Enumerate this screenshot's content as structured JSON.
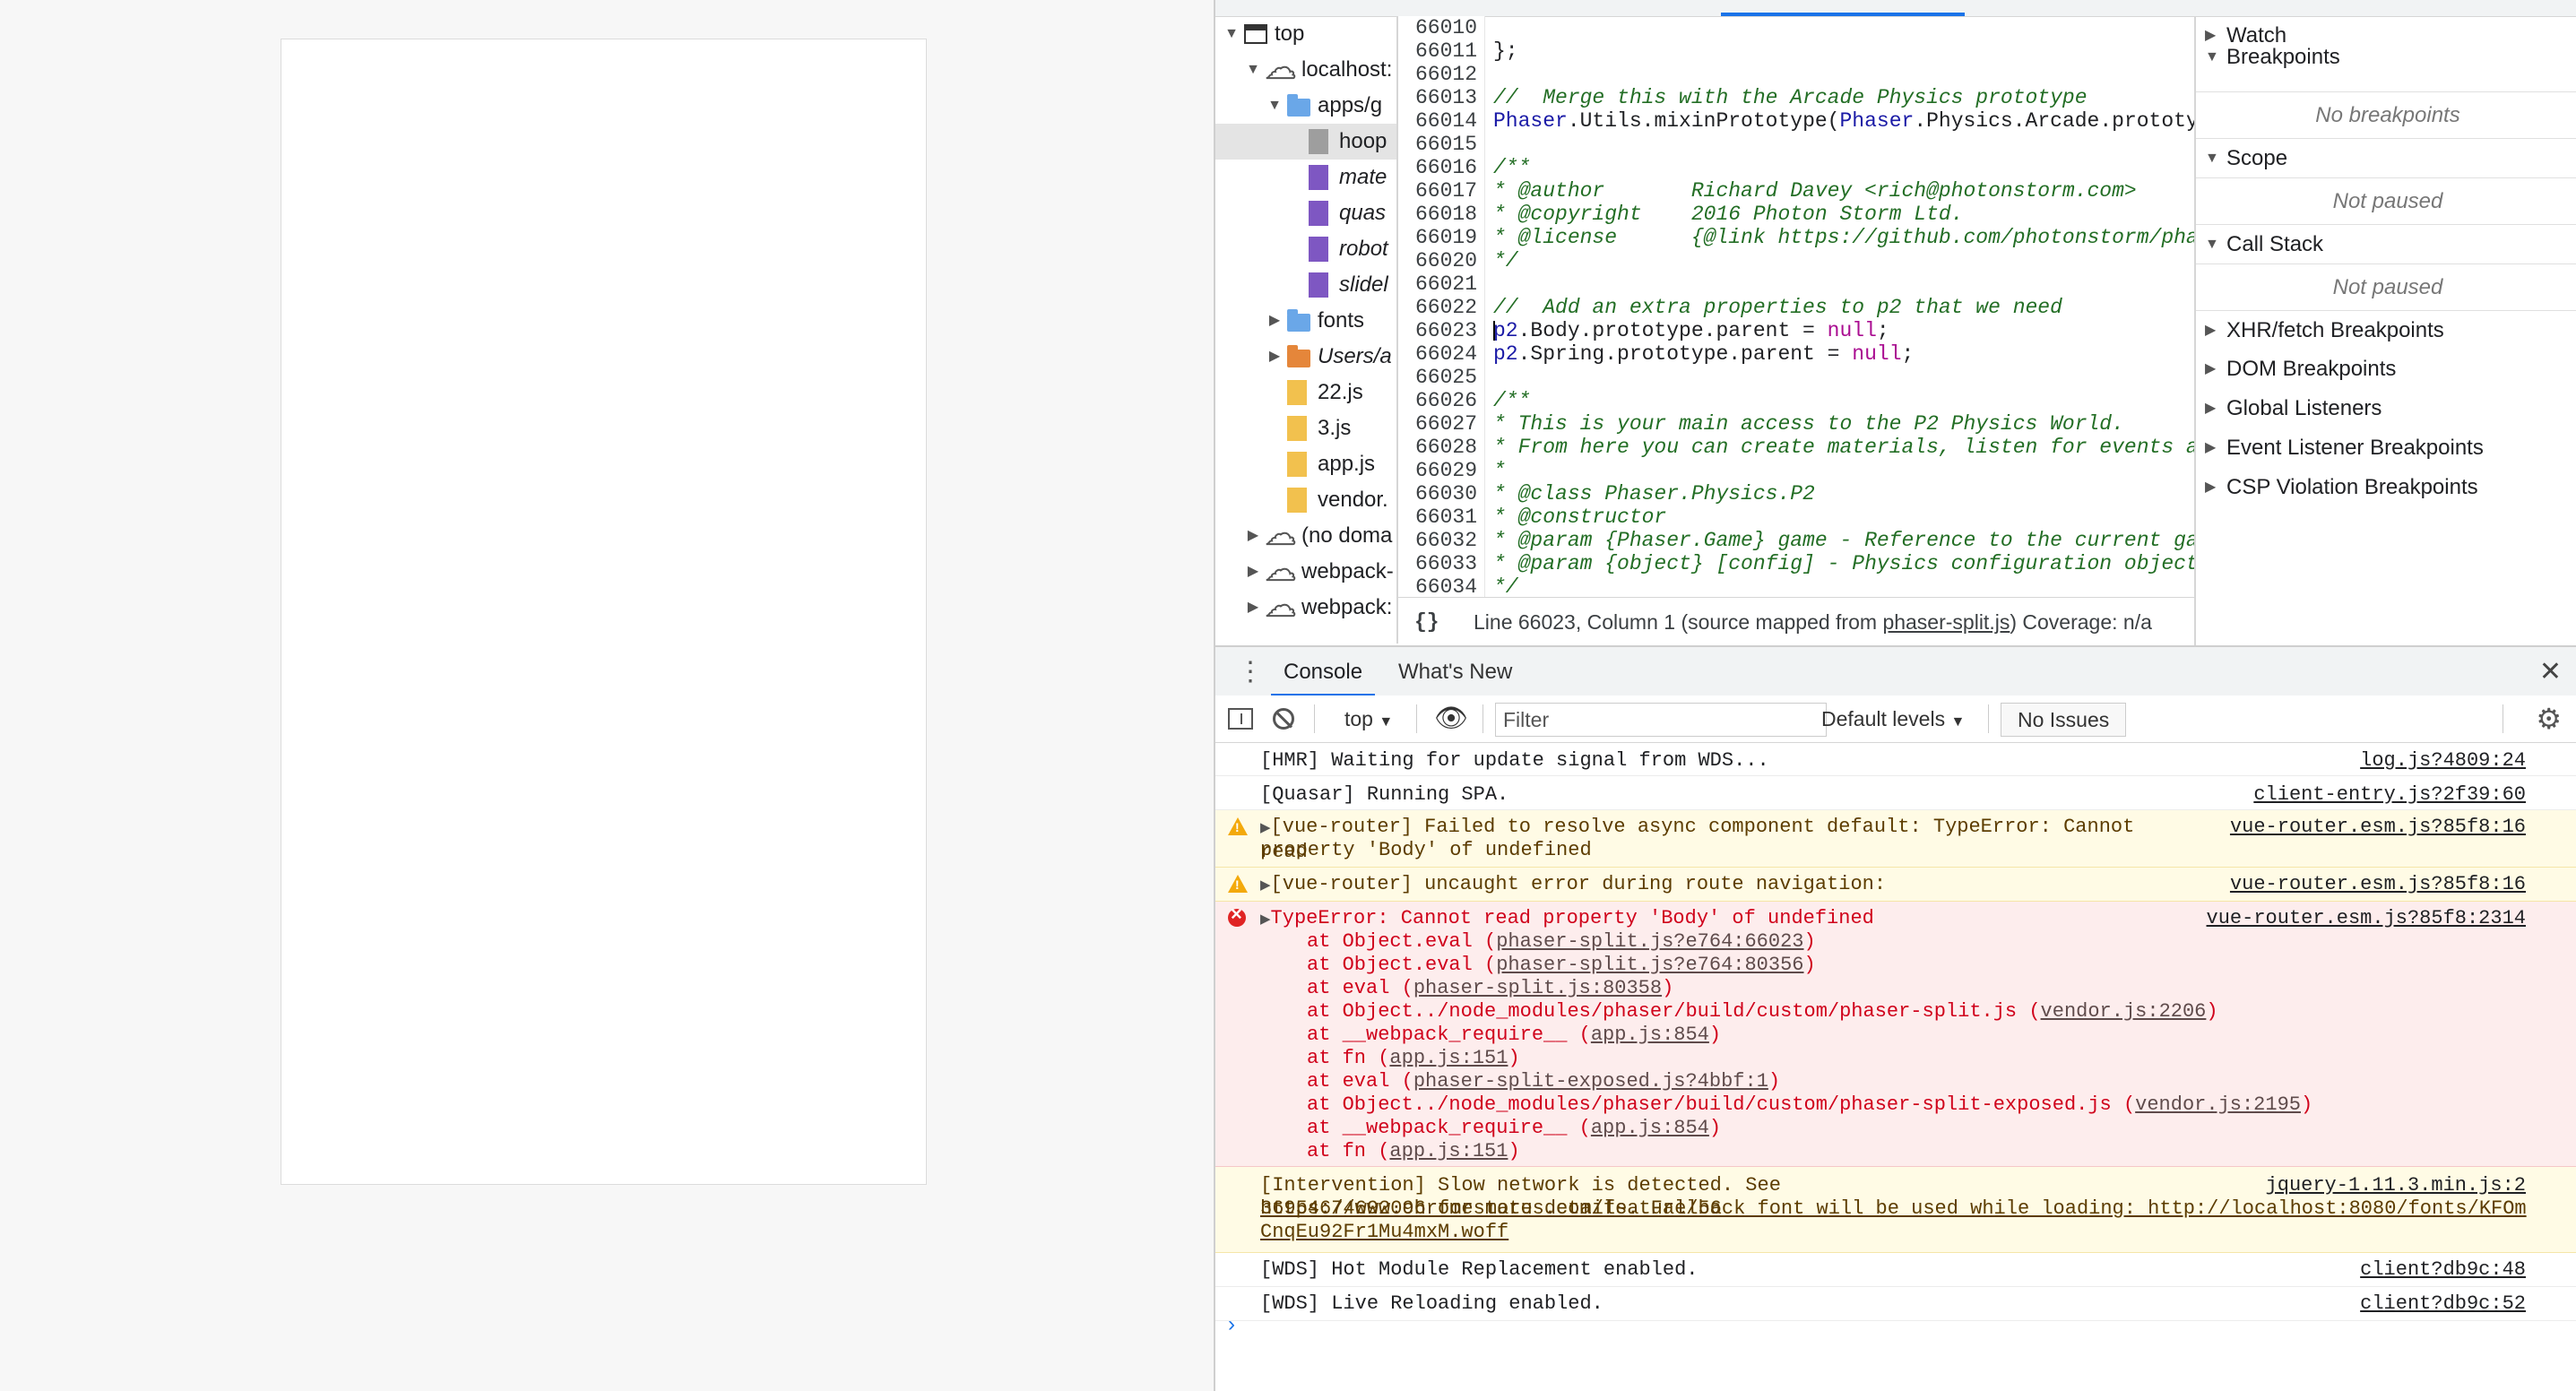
{
  "navigator": {
    "items": [
      {
        "label": "top",
        "type": "frame",
        "arrow": "▼"
      },
      {
        "label": "localhost:",
        "type": "cloud",
        "arrow": "▼"
      },
      {
        "label": "apps/g",
        "type": "folder",
        "arrow": "▼"
      },
      {
        "label": "hoop",
        "type": "file-gray",
        "arrow": ""
      },
      {
        "label": "mate",
        "type": "file-purple",
        "arrow": "",
        "italic": true
      },
      {
        "label": "quas",
        "type": "file-purple",
        "arrow": "",
        "italic": true
      },
      {
        "label": "robot",
        "type": "file-purple",
        "arrow": "",
        "italic": true
      },
      {
        "label": "slidel",
        "type": "file-purple",
        "arrow": "",
        "italic": true
      },
      {
        "label": "fonts",
        "type": "folder",
        "arrow": "▶"
      },
      {
        "label": "Users/a",
        "type": "folder-orange",
        "arrow": "▶",
        "italic": true
      },
      {
        "label": "22.js",
        "type": "file-yellow",
        "arrow": ""
      },
      {
        "label": "3.js",
        "type": "file-yellow",
        "arrow": ""
      },
      {
        "label": "app.js",
        "type": "file-yellow",
        "arrow": ""
      },
      {
        "label": "vendor.",
        "type": "file-yellow",
        "arrow": ""
      },
      {
        "label": "(no doma",
        "type": "cloud",
        "arrow": "▶"
      },
      {
        "label": "webpack-",
        "type": "cloud",
        "arrow": "▶"
      },
      {
        "label": "webpack:",
        "type": "cloud",
        "arrow": "▶"
      }
    ]
  },
  "editor": {
    "lines": [
      {
        "n": "66010",
        "text": ""
      },
      {
        "n": "66011",
        "text": "};"
      },
      {
        "n": "66012",
        "text": ""
      },
      {
        "n": "66013",
        "text": "//  Merge this with the Arcade Physics prototype",
        "kind": "comment"
      },
      {
        "n": "66014",
        "text": "Phaser.Utils.mixinPrototype(Phaser.Physics.Arcade.prototype",
        "kind": "ident"
      },
      {
        "n": "66015",
        "text": ""
      },
      {
        "n": "66016",
        "text": "/**",
        "kind": "comment"
      },
      {
        "n": "66017",
        "text": "* @author       Richard Davey <rich@photonstorm.com>",
        "kind": "comment"
      },
      {
        "n": "66018",
        "text": "* @copyright    2016 Photon Storm Ltd.",
        "kind": "comment"
      },
      {
        "n": "66019",
        "text": "* @license      {@link https://github.com/photonstorm/phase",
        "kind": "comment"
      },
      {
        "n": "66020",
        "text": "*/",
        "kind": "comment"
      },
      {
        "n": "66021",
        "text": ""
      },
      {
        "n": "66022",
        "text": "//  Add an extra properties to p2 that we need",
        "kind": "comment"
      },
      {
        "n": "66023",
        "text": "p2.Body.prototype.parent = null;",
        "kind": "ident",
        "cursor": true
      },
      {
        "n": "66024",
        "text": "p2.Spring.prototype.parent = null;",
        "kind": "ident"
      },
      {
        "n": "66025",
        "text": ""
      },
      {
        "n": "66026",
        "text": "/**",
        "kind": "comment"
      },
      {
        "n": "66027",
        "text": "* This is your main access to the P2 Physics World.",
        "kind": "comment"
      },
      {
        "n": "66028",
        "text": "* From here you can create materials, listen for events and",
        "kind": "comment"
      },
      {
        "n": "66029",
        "text": "*",
        "kind": "comment"
      },
      {
        "n": "66030",
        "text": "* @class Phaser.Physics.P2",
        "kind": "comment"
      },
      {
        "n": "66031",
        "text": "* @constructor",
        "kind": "comment"
      },
      {
        "n": "66032",
        "text": "* @param {Phaser.Game} game - Reference to the current game",
        "kind": "comment"
      },
      {
        "n": "66033",
        "text": "* @param {object} [config] - Physics configuration object p",
        "kind": "comment"
      },
      {
        "n": "66034",
        "text": "*/",
        "kind": "comment"
      }
    ],
    "status": {
      "braces": "{}",
      "position": "Line 66023, Column 1",
      "source_prefix": "(source mapped from ",
      "source_file": "phaser-split.js",
      "source_suffix": ")",
      "coverage": "Coverage: n/a"
    }
  },
  "debugger": {
    "watch": "Watch",
    "breakpoints": "Breakpoints",
    "no_breakpoints": "No breakpoints",
    "scope": "Scope",
    "scope_msg": "Not paused",
    "call_stack": "Call Stack",
    "call_stack_msg": "Not paused",
    "xhr": "XHR/fetch Breakpoints",
    "dom": "DOM Breakpoints",
    "global": "Global Listeners",
    "event": "Event Listener Breakpoints",
    "csp": "CSP Violation Breakpoints"
  },
  "drawer": {
    "tabs": [
      "Console",
      "What's New"
    ],
    "context": "top",
    "filter_placeholder": "Filter",
    "levels": "Default levels",
    "issues": "No Issues"
  },
  "console": {
    "messages": [
      {
        "level": "log",
        "text": "[HMR] Waiting for update signal from WDS...",
        "source": "log.js?4809:24"
      },
      {
        "level": "log",
        "text": "[Quasar] Running SPA.",
        "source": "client-entry.js?2f39:60"
      },
      {
        "level": "warn",
        "text": "[vue-router] Failed to resolve async component default: TypeError: Cannot read",
        "text2": "property 'Body' of undefined",
        "source": "vue-router.esm.js?85f8:16"
      },
      {
        "level": "warn",
        "text": "[vue-router] uncaught error during route navigation:",
        "source": "vue-router.esm.js?85f8:16"
      },
      {
        "level": "error",
        "text": "TypeError: Cannot read property 'Body' of undefined",
        "source": "vue-router.esm.js?85f8:2314"
      },
      {
        "level": "log",
        "text": "[Intervention] Slow network is detected. See https://www.chromestatus.com/feature/56",
        "text_b": "36954674692096 for more details. Fallback font will be used while loading: http://localhost:8080/fonts/KFOm",
        "text_c": "CnqEu92Fr1Mu4mxM.woff",
        "source": "jquery-1.11.3.min.js:2"
      },
      {
        "level": "log",
        "text": "[WDS] Hot Module Replacement enabled.",
        "source": "client?db9c:48"
      },
      {
        "level": "log",
        "text": "[WDS] Live Reloading enabled.",
        "source": "client?db9c:52"
      }
    ],
    "stack": [
      {
        "pre": "at Object.eval (",
        "link": "phaser-split.js?e764:66023",
        "post": ")"
      },
      {
        "pre": "at Object.eval (",
        "link": "phaser-split.js?e764:80356",
        "post": ")"
      },
      {
        "pre": "at eval (",
        "link": "phaser-split.js:80358",
        "post": ")"
      },
      {
        "pre": "at Object../node_modules/phaser/build/custom/phaser-split.js (",
        "link": "vendor.js:2206",
        "post": ")"
      },
      {
        "pre": "at __webpack_require__ (",
        "link": "app.js:854",
        "post": ")"
      },
      {
        "pre": "at fn (",
        "link": "app.js:151",
        "post": ")"
      },
      {
        "pre": "at eval (",
        "link": "phaser-split-exposed.js?4bbf:1",
        "post": ")"
      },
      {
        "pre": "at Object../node_modules/phaser/build/custom/phaser-split-exposed.js (",
        "link": "vendor.js:2195",
        "post": ")"
      },
      {
        "pre": "at __webpack_require__ (",
        "link": "app.js:854",
        "post": ")"
      },
      {
        "pre": "at fn (",
        "link": "app.js:151",
        "post": ")"
      }
    ],
    "prompt": "›"
  }
}
